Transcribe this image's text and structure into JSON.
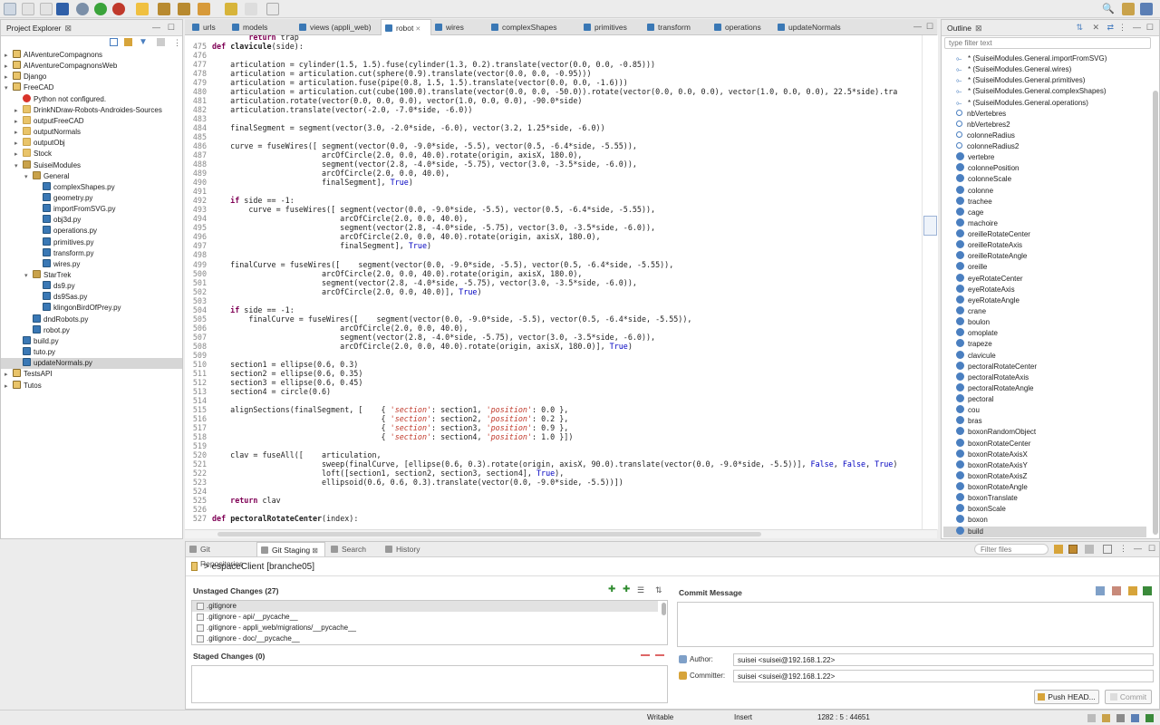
{
  "project_explorer": {
    "title": "Project Explorer",
    "items": [
      {
        "label": "AIAventureCompagnons",
        "depth": 0,
        "icon": "proj",
        "tw": "▸"
      },
      {
        "label": "AIAventureCompagnonsWeb",
        "depth": 0,
        "icon": "proj",
        "tw": "▸"
      },
      {
        "label": "Django",
        "depth": 0,
        "icon": "proj",
        "tw": "▸"
      },
      {
        "label": "FreeCAD",
        "depth": 0,
        "icon": "proj",
        "tw": "▾"
      },
      {
        "label": "Python not configured.",
        "depth": 1,
        "icon": "err",
        "tw": ""
      },
      {
        "label": "DrinkNDraw-Robots-Androides-Sources",
        "depth": 1,
        "icon": "folder",
        "tw": "▸"
      },
      {
        "label": "outputFreeCAD",
        "depth": 1,
        "icon": "folder",
        "tw": "▸"
      },
      {
        "label": "outputNormals",
        "depth": 1,
        "icon": "folder",
        "tw": "▸"
      },
      {
        "label": "outputObj",
        "depth": 1,
        "icon": "folder",
        "tw": "▸"
      },
      {
        "label": "Stock",
        "depth": 1,
        "icon": "folder",
        "tw": "▸"
      },
      {
        "label": "SuiseiModules",
        "depth": 1,
        "icon": "pkg",
        "tw": "▾"
      },
      {
        "label": "General",
        "depth": 2,
        "icon": "pkg",
        "tw": "▾"
      },
      {
        "label": "complexShapes.py",
        "depth": 3,
        "icon": "py",
        "tw": ""
      },
      {
        "label": "geometry.py",
        "depth": 3,
        "icon": "py",
        "tw": ""
      },
      {
        "label": "importFromSVG.py",
        "depth": 3,
        "icon": "py",
        "tw": ""
      },
      {
        "label": "obj3d.py",
        "depth": 3,
        "icon": "py",
        "tw": ""
      },
      {
        "label": "operations.py",
        "depth": 3,
        "icon": "py",
        "tw": ""
      },
      {
        "label": "primitives.py",
        "depth": 3,
        "icon": "py",
        "tw": ""
      },
      {
        "label": "transform.py",
        "depth": 3,
        "icon": "py",
        "tw": ""
      },
      {
        "label": "wires.py",
        "depth": 3,
        "icon": "py",
        "tw": ""
      },
      {
        "label": "StarTrek",
        "depth": 2,
        "icon": "pkg",
        "tw": "▾"
      },
      {
        "label": "ds9.py",
        "depth": 3,
        "icon": "py",
        "tw": ""
      },
      {
        "label": "ds9Sas.py",
        "depth": 3,
        "icon": "py",
        "tw": ""
      },
      {
        "label": "klingonBirdOfPrey.py",
        "depth": 3,
        "icon": "py",
        "tw": ""
      },
      {
        "label": "dndRobots.py",
        "depth": 2,
        "icon": "py",
        "tw": ""
      },
      {
        "label": "robot.py",
        "depth": 2,
        "icon": "py",
        "tw": ""
      },
      {
        "label": "build.py",
        "depth": 1,
        "icon": "py",
        "tw": ""
      },
      {
        "label": "tuto.py",
        "depth": 1,
        "icon": "py",
        "tw": ""
      },
      {
        "label": "updateNormals.py",
        "depth": 1,
        "icon": "py",
        "tw": "",
        "selected": true
      },
      {
        "label": "TestsAPI",
        "depth": 0,
        "icon": "proj",
        "tw": "▸"
      },
      {
        "label": "Tutos",
        "depth": 0,
        "icon": "proj",
        "tw": "▸"
      }
    ]
  },
  "editor": {
    "tabs": [
      "urls",
      "models",
      "views (appli_web)",
      "robot",
      "wires",
      "complexShapes",
      "primitives",
      "transform",
      "operations",
      "updateNormals"
    ],
    "active_tab": "robot",
    "lines": [
      {
        "n": "",
        "t": "        return trap"
      },
      {
        "n": "475",
        "t": "def clavicule(side):"
      },
      {
        "n": "476",
        "t": ""
      },
      {
        "n": "477",
        "t": "    articulation = cylinder(1.5, 1.5).fuse(cylinder(1.3, 0.2).translate(vector(0.0, 0.0, -0.85)))"
      },
      {
        "n": "478",
        "t": "    articulation = articulation.cut(sphere(0.9).translate(vector(0.0, 0.0, -0.95)))"
      },
      {
        "n": "479",
        "t": "    articulation = articulation.fuse(pipe(0.8, 1.5, 1.5).translate(vector(0.0, 0.0, -1.6)))"
      },
      {
        "n": "480",
        "t": "    articulation = articulation.cut(cube(100.0).translate(vector(0.0, 0.0, -50.0)).rotate(vector(0.0, 0.0, 0.0), vector(1.0, 0.0, 0.0), 22.5*side).tra"
      },
      {
        "n": "481",
        "t": "    articulation.rotate(vector(0.0, 0.0, 0.0), vector(1.0, 0.0, 0.0), -90.0*side)"
      },
      {
        "n": "482",
        "t": "    articulation.translate(vector(-2.0, -7.0*side, -6.0))"
      },
      {
        "n": "483",
        "t": ""
      },
      {
        "n": "484",
        "t": "    finalSegment = segment(vector(3.0, -2.0*side, -6.0), vector(3.2, 1.25*side, -6.0))"
      },
      {
        "n": "485",
        "t": ""
      },
      {
        "n": "486",
        "t": "    curve = fuseWires([ segment(vector(0.0, -9.0*side, -5.5), vector(0.5, -6.4*side, -5.55)),"
      },
      {
        "n": "487",
        "t": "                        arcOfCircle(2.0, 0.0, 40.0).rotate(origin, axisX, 180.0),"
      },
      {
        "n": "488",
        "t": "                        segment(vector(2.8, -4.0*side, -5.75), vector(3.0, -3.5*side, -6.0)),"
      },
      {
        "n": "489",
        "t": "                        arcOfCircle(2.0, 0.0, 40.0),"
      },
      {
        "n": "490",
        "t": "                        finalSegment], True)"
      },
      {
        "n": "491",
        "t": ""
      },
      {
        "n": "492",
        "t": "    if side == -1:"
      },
      {
        "n": "493",
        "t": "        curve = fuseWires([ segment(vector(0.0, -9.0*side, -5.5), vector(0.5, -6.4*side, -5.55)),"
      },
      {
        "n": "494",
        "t": "                            arcOfCircle(2.0, 0.0, 40.0),"
      },
      {
        "n": "495",
        "t": "                            segment(vector(2.8, -4.0*side, -5.75), vector(3.0, -3.5*side, -6.0)),"
      },
      {
        "n": "496",
        "t": "                            arcOfCircle(2.0, 0.0, 40.0).rotate(origin, axisX, 180.0),"
      },
      {
        "n": "497",
        "t": "                            finalSegment], True)"
      },
      {
        "n": "498",
        "t": ""
      },
      {
        "n": "499",
        "t": "    finalCurve = fuseWires([    segment(vector(0.0, -9.0*side, -5.5), vector(0.5, -6.4*side, -5.55)),"
      },
      {
        "n": "500",
        "t": "                        arcOfCircle(2.0, 0.0, 40.0).rotate(origin, axisX, 180.0),"
      },
      {
        "n": "501",
        "t": "                        segment(vector(2.8, -4.0*side, -5.75), vector(3.0, -3.5*side, -6.0)),"
      },
      {
        "n": "502",
        "t": "                        arcOfCircle(2.0, 0.0, 40.0)], True)"
      },
      {
        "n": "503",
        "t": ""
      },
      {
        "n": "504",
        "t": "    if side == -1:"
      },
      {
        "n": "505",
        "t": "        finalCurve = fuseWires([    segment(vector(0.0, -9.0*side, -5.5), vector(0.5, -6.4*side, -5.55)),"
      },
      {
        "n": "506",
        "t": "                            arcOfCircle(2.0, 0.0, 40.0),"
      },
      {
        "n": "507",
        "t": "                            segment(vector(2.8, -4.0*side, -5.75), vector(3.0, -3.5*side, -6.0)),"
      },
      {
        "n": "508",
        "t": "                            arcOfCircle(2.0, 0.0, 40.0).rotate(origin, axisX, 180.0)], True)"
      },
      {
        "n": "509",
        "t": ""
      },
      {
        "n": "510",
        "t": "    section1 = ellipse(0.6, 0.3)"
      },
      {
        "n": "511",
        "t": "    section2 = ellipse(0.6, 0.35)"
      },
      {
        "n": "512",
        "t": "    section3 = ellipse(0.6, 0.45)"
      },
      {
        "n": "513",
        "t": "    section4 = circle(0.6)"
      },
      {
        "n": "514",
        "t": ""
      },
      {
        "n": "515",
        "t": "    alignSections(finalSegment, [    { 'section': section1, 'position': 0.0 },"
      },
      {
        "n": "516",
        "t": "                                     { 'section': section2, 'position': 0.2 },"
      },
      {
        "n": "517",
        "t": "                                     { 'section': section3, 'position': 0.9 },"
      },
      {
        "n": "518",
        "t": "                                     { 'section': section4, 'position': 1.0 }])"
      },
      {
        "n": "519",
        "t": ""
      },
      {
        "n": "520",
        "t": "    clav = fuseAll([    articulation,"
      },
      {
        "n": "521",
        "t": "                        sweep(finalCurve, [ellipse(0.6, 0.3).rotate(origin, axisX, 90.0).translate(vector(0.0, -9.0*side, -5.5))], False, False, True)"
      },
      {
        "n": "522",
        "t": "                        loft([section1, section2, section3, section4], True),"
      },
      {
        "n": "523",
        "t": "                        ellipsoid(0.6, 0.6, 0.3).translate(vector(0.0, -9.0*side, -5.5))])"
      },
      {
        "n": "524",
        "t": ""
      },
      {
        "n": "525",
        "t": "    return clav"
      },
      {
        "n": "526",
        "t": ""
      },
      {
        "n": "527",
        "t": "def pectoralRotateCenter(index):"
      }
    ]
  },
  "outline": {
    "title": "Outline",
    "filter_placeholder": "type filter text",
    "imports": [
      "* (SuiseiModules.General.importFromSVG)",
      "* (SuiseiModules.General.wires)",
      "* (SuiseiModules.General.primitives)",
      "* (SuiseiModules.General.complexShapes)",
      "* (SuiseiModules.General.operations)"
    ],
    "vars": [
      "nbVertebres",
      "nbVertebres2",
      "colonneRadius",
      "colonneRadius2"
    ],
    "funcs": [
      "vertebre",
      "colonnePosition",
      "colonneScale",
      "colonne",
      "trachee",
      "cage",
      "machoire",
      "oreilleRotateCenter",
      "oreilleRotateAxis",
      "oreilleRotateAngle",
      "oreille",
      "eyeRotateCenter",
      "eyeRotateAxis",
      "eyeRotateAngle",
      "crane",
      "boulon",
      "omoplate",
      "trapeze",
      "clavicule",
      "pectoralRotateCenter",
      "pectoralRotateAxis",
      "pectoralRotateAngle",
      "pectoral",
      "cou",
      "bras",
      "boxonRandomObject",
      "boxonRotateCenter",
      "boxonRotateAxisX",
      "boxonRotateAxisY",
      "boxonRotateAxisZ",
      "boxonRotateAngle",
      "boxonTranslate",
      "boxonScale",
      "boxon",
      "build"
    ],
    "selected": "build"
  },
  "bottom": {
    "tabs": [
      "Git Repositories",
      "Git Staging",
      "Search",
      "History"
    ],
    "active_tab": "Git Staging",
    "filter_placeholder": "Filter files",
    "repo": "> espaceClient [branche05]",
    "unstaged_title": "Unstaged Changes (27)",
    "unstaged": [
      ".gitignore",
      ".gitignore - api/__pycache__",
      ".gitignore - appli_web/migrations/__pycache__",
      ".gitignore - doc/__pycache__"
    ],
    "staged_title": "Staged Changes (0)",
    "commit_title": "Commit Message",
    "author_label": "Author:",
    "author": "suisei <suisei@192.168.1.22>",
    "committer_label": "Committer:",
    "committer": "suisei <suisei@192.168.1.22>",
    "push_label": "Push HEAD...",
    "commit_label": "Commit"
  },
  "status": {
    "writable": "Writable",
    "insert": "Insert",
    "position": "1282 : 5 : 44651"
  }
}
